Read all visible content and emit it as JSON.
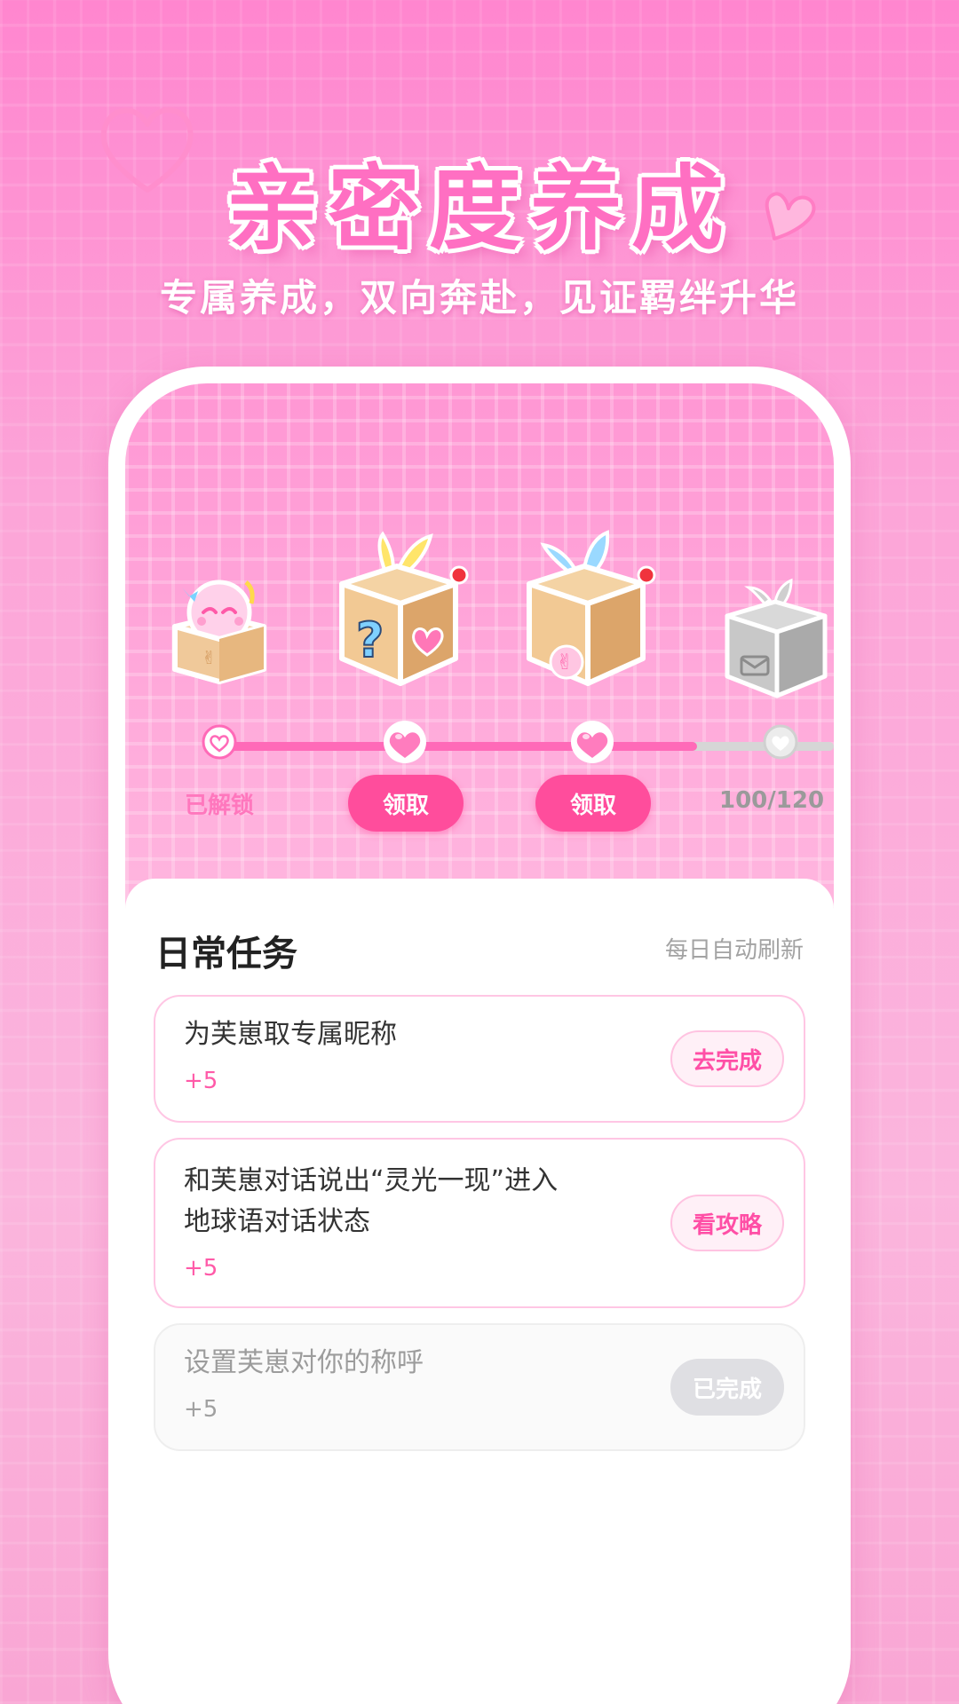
{
  "hero": {
    "title": "亲密度养成",
    "subtitle": "专属养成，双向奔赴，见证羁绊升华"
  },
  "milestones": [
    {
      "state": "unlocked",
      "label": "已解锁",
      "icon": "character-in-box-icon"
    },
    {
      "state": "claimable",
      "label": "领取",
      "icon": "mystery-box-heart-icon"
    },
    {
      "state": "claimable",
      "label": "领取",
      "icon": "mystery-box-peace-icon"
    },
    {
      "state": "locked",
      "label": "100/120",
      "icon": "locked-gray-box-icon"
    }
  ],
  "progress": {
    "fraction": 0.78
  },
  "tasks_panel": {
    "title": "日常任务",
    "hint": "每日自动刷新",
    "tasks": [
      {
        "title": "为芙崽取专属昵称",
        "points": "+5",
        "action": "去完成",
        "done": false
      },
      {
        "title_line1": "和芙崽对话说出“灵光一现”进入",
        "title_line2": "地球语对话状态",
        "points": "+5",
        "action": "看攻略",
        "done": false
      },
      {
        "title": "设置芙崽对你的称呼",
        "points": "+5",
        "action": "已完成",
        "done": true
      }
    ]
  },
  "colors": {
    "accent": "#ff4d9c",
    "title_pink": "#ff6fc2",
    "track_fill": "#ff6ab8",
    "track_empty": "#d6d6d6"
  }
}
